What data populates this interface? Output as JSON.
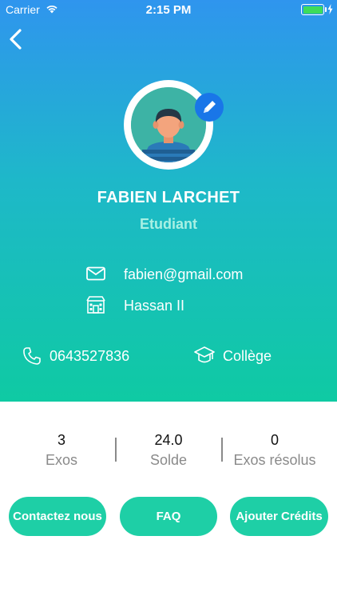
{
  "status_bar": {
    "carrier": "Carrier",
    "time": "2:15 PM",
    "battery_level": 1.0
  },
  "profile": {
    "name": "FABIEN LARCHET",
    "role": "Etudiant",
    "email": "fabien@gmail.com",
    "school": "Hassan II",
    "phone": "0643527836",
    "level": "Collège"
  },
  "stats": [
    {
      "value": "3",
      "label": "Exos"
    },
    {
      "value": "24.0",
      "label": "Solde"
    },
    {
      "value": "0",
      "label": "Exos résolus"
    }
  ],
  "buttons": {
    "contact": "Contactez nous",
    "faq": "FAQ",
    "credits": "Ajouter Crédits"
  },
  "colors": {
    "gradient_top": "#2f95ee",
    "gradient_bottom": "#0fcaa3",
    "button": "#1ecfa6",
    "role_text": "#a8f0e3",
    "edit_badge": "#1976e8"
  },
  "icons": [
    "back-chevron-icon",
    "avatar-icon",
    "edit-pencil-icon",
    "mail-icon",
    "school-building-icon",
    "phone-icon",
    "graduation-cap-icon"
  ]
}
